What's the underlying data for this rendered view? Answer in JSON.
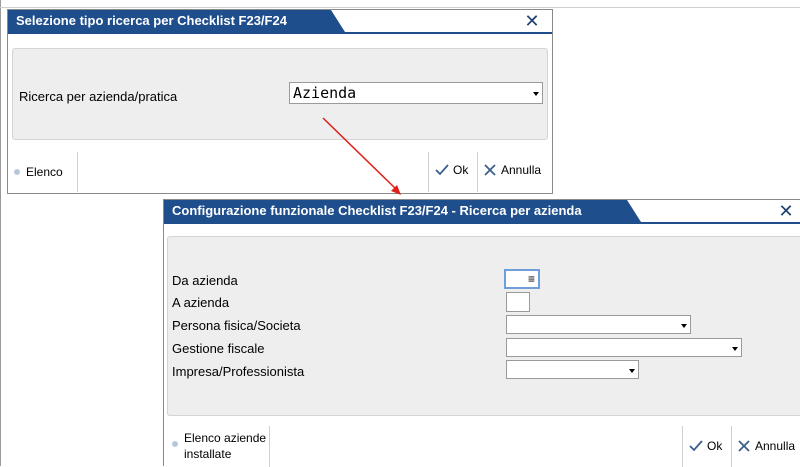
{
  "dialog1": {
    "title": "Selezione tipo ricerca per Checklist F23/F24",
    "field_label": "Ricerca per azienda/pratica",
    "select_value": "Azienda",
    "footer": {
      "elenco": "Elenco",
      "ok": "Ok",
      "annulla": "Annulla"
    }
  },
  "dialog2": {
    "title": "Configurazione funzionale Checklist F23/F24 - Ricerca per azienda",
    "fields": {
      "da_azienda": "Da azienda",
      "a_azienda": "A azienda",
      "persona": "Persona fisica/Societa",
      "gestione": "Gestione fiscale",
      "impresa": "Impresa/Professionista"
    },
    "footer": {
      "elenco_line1": "Elenco aziende",
      "elenco_line2": "installate",
      "ok": "Ok",
      "annulla": "Annulla"
    }
  },
  "colors": {
    "title_bg": "#1f4e8c",
    "arrow": "#e0201a",
    "panel_bg": "#eeeeee"
  },
  "icons": {
    "close": "close-icon",
    "ok": "checkmark-icon",
    "cancel": "x-icon",
    "dropdown": "dropdown-arrow-icon",
    "list": "list-icon"
  }
}
